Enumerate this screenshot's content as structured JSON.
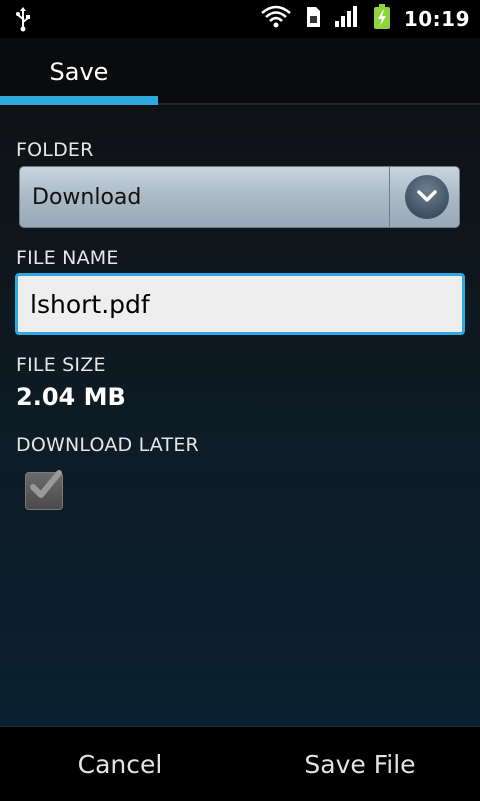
{
  "status_bar": {
    "time": "10:19",
    "icons": [
      "usb-icon",
      "wifi-icon",
      "sim-icon",
      "signal-icon",
      "battery-charging-icon"
    ]
  },
  "tabs": [
    {
      "label": "Save",
      "selected": true
    }
  ],
  "form": {
    "folder_label": "FOLDER",
    "folder_value": "Download",
    "file_name_label": "FILE NAME",
    "file_name_value": "lshort.pdf",
    "file_size_label": "FILE SIZE",
    "file_size_value": "2.04 MB",
    "download_later_label": "DOWNLOAD LATER",
    "download_later_checked": true
  },
  "footer": {
    "cancel_label": "Cancel",
    "save_label": "Save File"
  },
  "colors": {
    "accent": "#2ea8df",
    "input_bg": "#eeeeee"
  }
}
